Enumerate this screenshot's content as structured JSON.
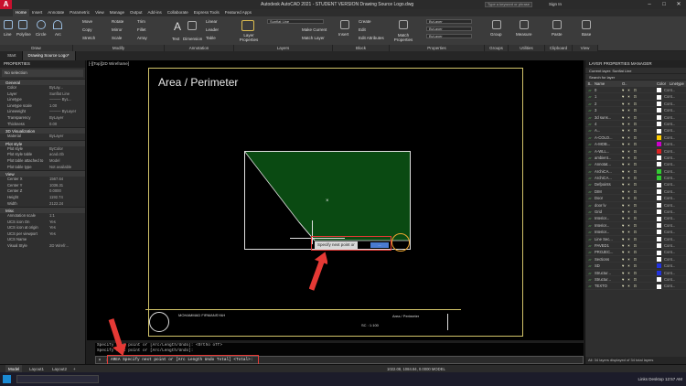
{
  "titlebar": {
    "title": "Autodesk AutoCAD 2021 - STUDENT VERSION   Drawing Source Logo.dwg",
    "search_placeholder": "Type a keyword or phrase",
    "signin": "Sign In"
  },
  "ribbon_tabs": [
    "Home",
    "Insert",
    "Annotate",
    "Parametric",
    "View",
    "Manage",
    "Output",
    "Add-ins",
    "Collaborate",
    "Express Tools",
    "Featured Apps"
  ],
  "ribbon": {
    "draw_tools": [
      "Line",
      "Polyline",
      "Circle",
      "Arc"
    ],
    "modify_tools": [
      "Move",
      "Rotate",
      "Trim",
      "Copy",
      "Mirror",
      "Fillet",
      "Stretch",
      "Scale",
      "Array"
    ],
    "annotation_tools": [
      "Text",
      "Dimension",
      "Linear",
      "Leader",
      "Table"
    ],
    "layer_tools": [
      "Layer Properties",
      "Make Current",
      "Match Layer"
    ],
    "layer_dropdown": "Sunflat Line",
    "block_tools": [
      "Insert",
      "Create",
      "Edit",
      "Edit Attributes"
    ],
    "properties_tools": [
      "Match Properties"
    ],
    "bylayer": "ByLayer",
    "other_tools": [
      "Group",
      "Measure",
      "Paste",
      "Base"
    ],
    "panels": [
      "Draw",
      "Modify",
      "Annotation",
      "Layers",
      "Block",
      "Properties",
      "Groups",
      "Utilities",
      "Clipboard",
      "View"
    ]
  },
  "doc_tabs": [
    "Start",
    "Drawing Source Logo*"
  ],
  "viewport_label": "[-][Top][2D Wireframe]",
  "drawing_title": "Area / Perimeter",
  "dynamic_input": {
    "prompt": "Specify next point or",
    "value": "..."
  },
  "title_block": {
    "name": "MOHAMMAD FIRMANSYAH",
    "title": "Area / Perimeter",
    "scale": "SC : 1:100"
  },
  "properties_panel": {
    "header": "PROPERTIES",
    "selection": "No selection",
    "sections": [
      {
        "name": "General",
        "rows": [
          [
            "Color",
            "ByLay..."
          ],
          [
            "Layer",
            "Sunflat Line"
          ],
          [
            "Linetype",
            "——— ByL..."
          ],
          [
            "Linetype scale",
            "1.00"
          ],
          [
            "Lineweight",
            "——— ByLayer"
          ],
          [
            "Transparency",
            "ByLayer"
          ],
          [
            "Thickness",
            "0.00"
          ]
        ]
      },
      {
        "name": "3D Visualization",
        "rows": [
          [
            "Material",
            "ByLayer"
          ]
        ]
      },
      {
        "name": "Plot style",
        "rows": [
          [
            "Plot style",
            "ByColor"
          ],
          [
            "Plot style table",
            "acad.ctb"
          ],
          [
            "Plot table attached to",
            "Model"
          ],
          [
            "Plot table type",
            "Not available"
          ]
        ]
      },
      {
        "name": "View",
        "rows": [
          [
            "Center X",
            "1567.64"
          ],
          [
            "Center Y",
            "1036.31"
          ],
          [
            "Center Z",
            "0.0000"
          ],
          [
            "Height",
            "1192.74"
          ],
          [
            "Width",
            "2122.24"
          ]
        ]
      },
      {
        "name": "Misc",
        "rows": [
          [
            "Annotation scale",
            "1:1"
          ],
          [
            "UCS icon On",
            "Yes"
          ],
          [
            "UCS icon at origin",
            "Yes"
          ],
          [
            "UCS per viewport",
            "Yes"
          ],
          [
            "UCS Name",
            ""
          ],
          [
            "Visual Style",
            "2D Wirefr..."
          ]
        ]
      }
    ]
  },
  "layers_panel": {
    "header": "LAYER PROPERTIES MANAGER",
    "current": "Current layer: Sunflat Line",
    "search": "Search for layer",
    "columns": [
      "S..",
      "Name",
      "O..",
      "Color",
      "Linetype"
    ],
    "rows": [
      {
        "name": "0",
        "color": "#ffffff",
        "lt": "Cont..."
      },
      {
        "name": "1",
        "color": "#ffffff",
        "lt": "Cont..."
      },
      {
        "name": "2",
        "color": "#ffffff",
        "lt": "Cont..."
      },
      {
        "name": "3",
        "color": "#ffffff",
        "lt": "Cont..."
      },
      {
        "name": "3d suns...",
        "color": "#ffffff",
        "lt": "Cont..."
      },
      {
        "name": "4",
        "color": "#ffffff",
        "lt": "Cont..."
      },
      {
        "name": "A...",
        "color": "#ffffff",
        "lt": "Cont..."
      },
      {
        "name": "A-COLO...",
        "color": "#ffcc00",
        "lt": "Cont..."
      },
      {
        "name": "A-MOB...",
        "color": "#cc00cc",
        "lt": "Cont..."
      },
      {
        "name": "A-WLL...",
        "color": "#dd2222",
        "lt": "Cont..."
      },
      {
        "name": "ambient...",
        "color": "#ffffff",
        "lt": "Cont..."
      },
      {
        "name": "Annotat...",
        "color": "#ffffff",
        "lt": "Cont..."
      },
      {
        "name": "ArchiCA...",
        "color": "#33cc33",
        "lt": "Cont..."
      },
      {
        "name": "ArchiCA...",
        "color": "#33cc33",
        "lt": "Cont..."
      },
      {
        "name": "Defpoints",
        "color": "#ffffff",
        "lt": "Cont..."
      },
      {
        "name": "DIM",
        "color": "#ffffff",
        "lt": "Cont..."
      },
      {
        "name": "Door",
        "color": "#ffffff",
        "lt": "Cont..."
      },
      {
        "name": "door lv",
        "color": "#ffffff",
        "lt": "Cont..."
      },
      {
        "name": "Grid",
        "color": "#ffffff",
        "lt": "Cont..."
      },
      {
        "name": "Interior...",
        "color": "#ffffff",
        "lt": "Cont..."
      },
      {
        "name": "Interior...",
        "color": "#ffffff",
        "lt": "Cont..."
      },
      {
        "name": "Interior...",
        "color": "#ffffff",
        "lt": "Cont..."
      },
      {
        "name": "Line Sec...",
        "color": "#ffffff",
        "lt": "Cont..."
      },
      {
        "name": "PAVED1",
        "color": "#ffffff",
        "lt": "Cont..."
      },
      {
        "name": "PROJEC...",
        "color": "#ffffff",
        "lt": "Cont..."
      },
      {
        "name": "Sections",
        "color": "#ffffff",
        "lt": "Cont..."
      },
      {
        "name": "SD",
        "color": "#2233dd",
        "lt": "Cont..."
      },
      {
        "name": "Structur...",
        "color": "#2233dd",
        "lt": "Cont..."
      },
      {
        "name": "Structur...",
        "color": "#ffffff",
        "lt": "Cont..."
      },
      {
        "name": "TEXTO",
        "color": "#ffffff",
        "lt": "Cont..."
      }
    ],
    "footer": "All: 34 layers displayed of 34 total layers"
  },
  "command": {
    "history": [
      "Specify next point or [Arc/Length/Undo]:  <Ortho off>",
      "Specify next point or [Arc/Length/Undo]:"
    ],
    "prompt": "AREA Specify next point or [Arc Length Undo Total] <Total>:"
  },
  "status": {
    "layout_tabs": [
      "Model",
      "Layout1",
      "Layout2"
    ],
    "coords": "1022.08, 1084.84, 0.0000   MODEL"
  },
  "taskbar": {
    "tray": "Links   Desktop   12:57 AM"
  }
}
